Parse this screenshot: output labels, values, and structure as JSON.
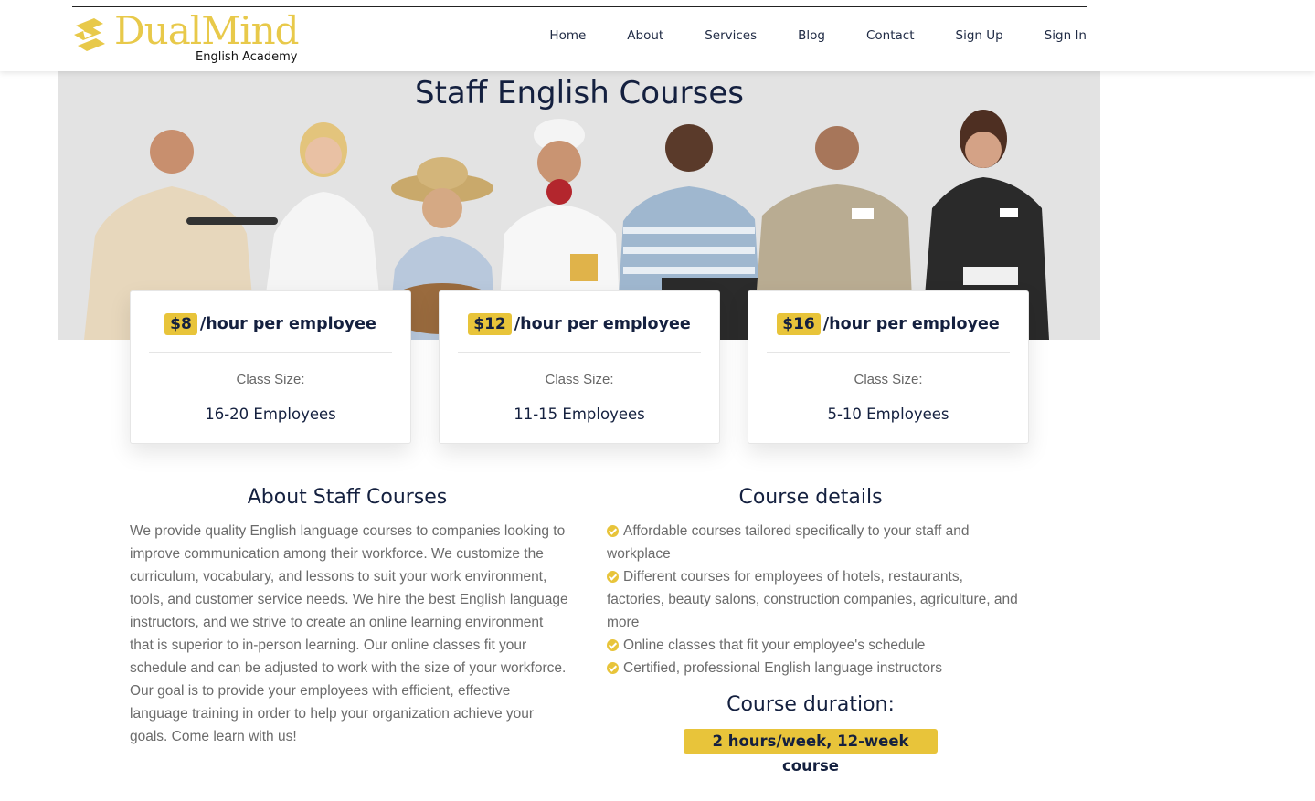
{
  "brand": {
    "name": "DualMind",
    "tagline": "English Academy",
    "color": "#E8C94A"
  },
  "nav": {
    "items": [
      "Home",
      "About",
      "Services",
      "Blog",
      "Contact",
      "Sign Up",
      "Sign In"
    ]
  },
  "hero": {
    "title": "Staff English Courses"
  },
  "pricing": [
    {
      "price": "$8",
      "unit": "/hour per employee",
      "size_label": "Class Size:",
      "size_value": "16-20 Employees"
    },
    {
      "price": "$12",
      "unit": "/hour per employee",
      "size_label": "Class Size:",
      "size_value": "11-15 Employees"
    },
    {
      "price": "$16",
      "unit": "/hour per employee",
      "size_label": "Class Size:",
      "size_value": "5-10 Employees"
    }
  ],
  "about": {
    "title": "About Staff Courses",
    "text": "We provide quality English language courses to companies looking to improve communication among their workforce. We customize the curriculum, vocabulary, and lessons to suit your work environment, tools, and customer service needs. We hire the best English language instructors, and we strive to create an online learning environment that is superior to in-person learning. Our online classes fit your schedule and can be adjusted to work with the size of your workforce. Our goal is to provide your employees with efficient, effective language training in order to help your organization achieve your goals. Come learn with us!"
  },
  "details": {
    "title": "Course details",
    "items": [
      "Affordable courses tailored specifically to your staff and workplace",
      "Different courses for employees of hotels, restaurants, factories, beauty salons, construction companies, agriculture, and more",
      "Online classes that fit your employee's schedule",
      "Certified, professional English language instructors"
    ],
    "icon": "check-circle-icon"
  },
  "duration": {
    "title": "Course duration:",
    "value": "2 hours/week, 12-week course"
  },
  "colors": {
    "accent": "#E8C43A",
    "heading": "#14203f",
    "body_text": "#6b6b6b",
    "hero_bg": "#e3e3e3"
  }
}
